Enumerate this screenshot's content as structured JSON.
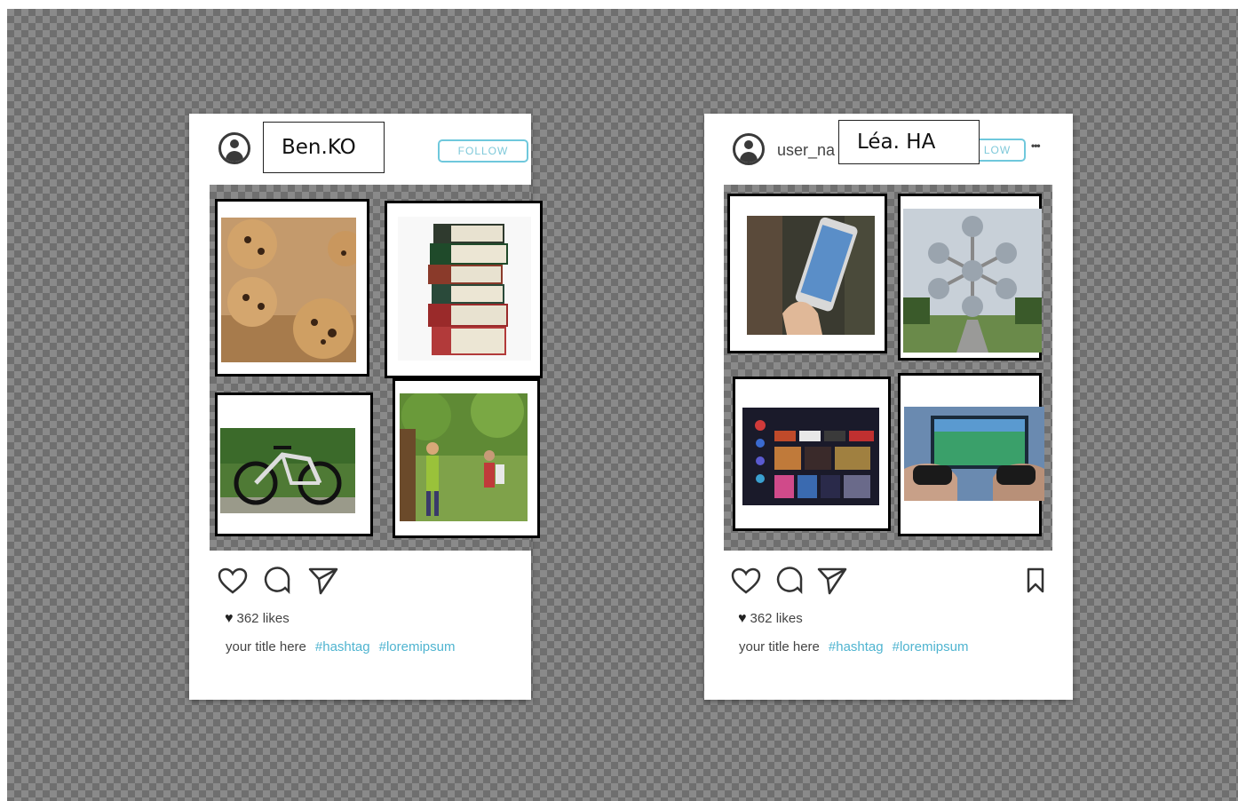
{
  "posts": [
    {
      "username": "Ben.KO",
      "follow_label": "FOLLOW",
      "images": [
        {
          "label": "cookies-photo"
        },
        {
          "label": "books-photo"
        },
        {
          "label": "bicycle-photo"
        },
        {
          "label": "children-playing-photo"
        }
      ],
      "likes": "362 likes",
      "caption": "your title here",
      "hashtags": [
        "#hashtag",
        "#loremipsum"
      ]
    },
    {
      "username_placeholder": "user_na",
      "username": "Léa. HA",
      "follow_label": "LOW",
      "more_label": "•••",
      "images": [
        {
          "label": "smartphone-photo"
        },
        {
          "label": "atomium-photo"
        },
        {
          "label": "smart-tv-photo"
        },
        {
          "label": "video-game-photo"
        }
      ],
      "likes": "362 likes",
      "caption": "your title here",
      "hashtags": [
        "#hashtag",
        "#loremipsum"
      ]
    }
  ],
  "colors": {
    "accent": "#4fb4d0",
    "follow_border": "#6fc8dc",
    "icon": "#3a3a3a"
  },
  "icons": [
    "user-avatar-icon",
    "heart-icon",
    "comment-icon",
    "send-icon",
    "bookmark-icon",
    "more-icon"
  ]
}
